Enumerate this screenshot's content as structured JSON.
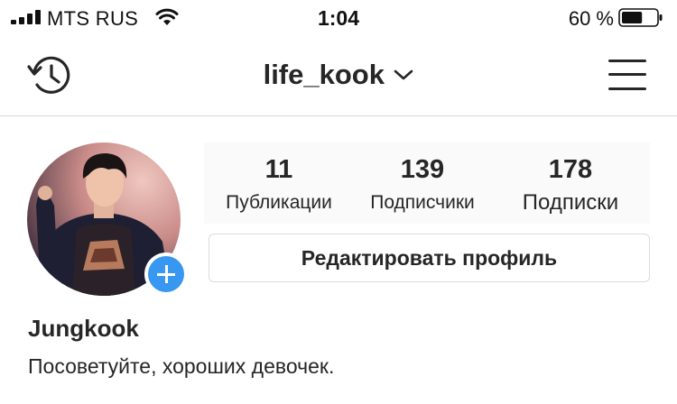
{
  "status_bar": {
    "carrier": "MTS RUS",
    "time": "1:04",
    "battery_percent": "60 %",
    "battery_level": 0.6,
    "signal_bars": 4
  },
  "nav": {
    "username": "life_kook",
    "history_icon": "history-icon",
    "dropdown_icon": "chevron-down-icon",
    "menu_icon": "hamburger-menu-icon"
  },
  "profile": {
    "display_name": "Jungkook",
    "bio": "Посоветуйте, хороших девочек.",
    "edit_button_label": "Редактировать профиль",
    "add_story_icon": "plus-icon",
    "stats": [
      {
        "value": "11",
        "label": "Публикации"
      },
      {
        "value": "139",
        "label": "Подписчики"
      },
      {
        "value": "178",
        "label": "Подписки"
      }
    ]
  },
  "colors": {
    "accent": "#3897f0",
    "text": "#262626",
    "border": "#dbdbdb"
  }
}
